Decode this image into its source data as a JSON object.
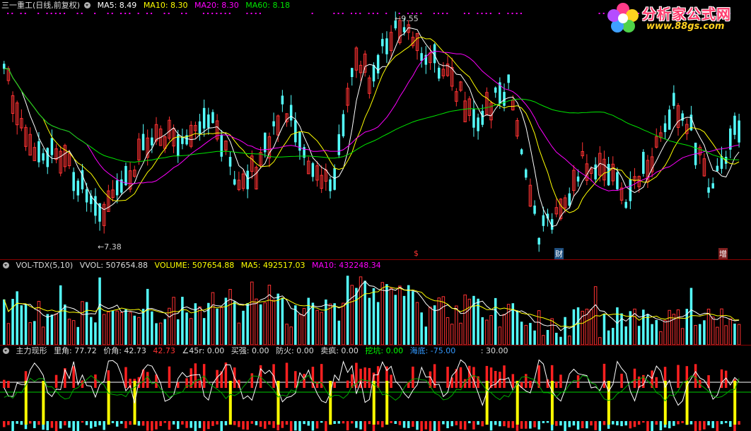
{
  "main": {
    "title": "三一重工(日线,前复权)",
    "ma5": "MA5: 8.49",
    "ma10": "MA10: 8.30",
    "ma20": "MA20: 8.30",
    "ma60": "MA60: 8.18",
    "high_label": "9.55",
    "low_label": "7.38",
    "markers": [
      "$",
      "财",
      "增"
    ]
  },
  "volume": {
    "name": "VOL-TDX(5,10)",
    "vvol": "VVOL: 507654.88",
    "volume": "VOLUME: 507654.88",
    "ma5": "MA5: 492517.03",
    "ma10": "MA10: 432248.34"
  },
  "indicator": {
    "name": "主力现形",
    "li_jiao": "里角: 77.72",
    "jia_jiao": "价角: 42.73",
    "val_red": "42.73",
    "angle": "∠45r: 0.00",
    "mai_qiang": "买强: 0.00",
    "fang_huo": "防火: 0.00",
    "mai_feng": "卖疯: 0.00",
    "wa_kang": "挖坑: 0.00",
    "hai_di": "海底: -75.00",
    "extra": ": 30.00"
  },
  "logo": {
    "name": "分析家公式网",
    "url": "www.88gs.com"
  },
  "colors": {
    "up": "#ff3232",
    "down": "#54ffff",
    "ma5": "#ffffff",
    "ma10": "#ffff00",
    "ma20": "#ff00ff",
    "ma60": "#00e600",
    "pane_border": "#8b0000"
  }
}
